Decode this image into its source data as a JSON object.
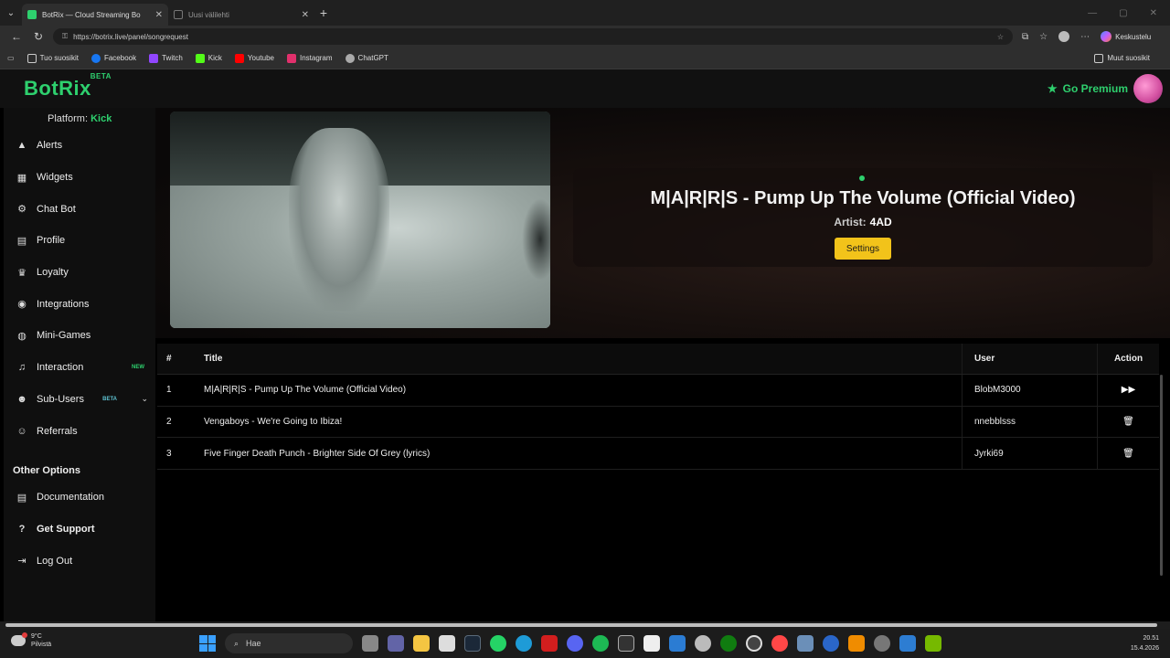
{
  "browser": {
    "tabs": [
      {
        "title": "BotRix — Cloud Streaming Bo",
        "active": true
      },
      {
        "title": "Uusi välilehti",
        "active": false
      }
    ],
    "url": "https://botrix.live/panel/songrequest",
    "copilot_label": "Keskustelu",
    "bookmarks": [
      {
        "label": "Tuo suosikit",
        "icon": "import-icon",
        "color": "#cccccc"
      },
      {
        "label": "Facebook",
        "icon": "facebook-icon",
        "color": "#1877f2"
      },
      {
        "label": "Twitch",
        "icon": "twitch-icon",
        "color": "#9146ff"
      },
      {
        "label": "Kick",
        "icon": "kick-icon",
        "color": "#53fc18"
      },
      {
        "label": "Youtube",
        "icon": "youtube-icon",
        "color": "#ff0000"
      },
      {
        "label": "Instagram",
        "icon": "instagram-icon",
        "color": "#e1306c"
      },
      {
        "label": "ChatGPT",
        "icon": "chatgpt-icon",
        "color": "#aaaaaa"
      }
    ],
    "other_bookmarks": "Muut suosikit"
  },
  "app": {
    "logo": "BotRix",
    "logo_badge": "BETA",
    "premium_label": "Go Premium",
    "platform_label": "Platform:",
    "platform_value": "Kick",
    "nav": [
      {
        "label": "Alerts",
        "icon": "warning-icon",
        "glyph": "▲"
      },
      {
        "label": "Widgets",
        "icon": "grid-icon",
        "glyph": "▦"
      },
      {
        "label": "Chat Bot",
        "icon": "robot-icon",
        "glyph": "⚙"
      },
      {
        "label": "Profile",
        "icon": "id-card-icon",
        "glyph": "▤"
      },
      {
        "label": "Loyalty",
        "icon": "trophy-icon",
        "glyph": "♛"
      },
      {
        "label": "Integrations",
        "icon": "integrations-icon",
        "glyph": "◉"
      },
      {
        "label": "Mini-Games",
        "icon": "gamepad-icon",
        "glyph": "◍"
      },
      {
        "label": "Interaction",
        "icon": "music-icon",
        "glyph": "♫",
        "badge": "NEW"
      },
      {
        "label": "Sub-Users",
        "icon": "users-icon",
        "glyph": "☻",
        "badge": "BETA"
      },
      {
        "label": "Referrals",
        "icon": "referrals-icon",
        "glyph": "☺"
      }
    ],
    "other_options_title": "Other Options",
    "other_nav": [
      {
        "label": "Documentation",
        "icon": "book-icon",
        "glyph": "▤"
      },
      {
        "label": "Get Support",
        "icon": "question-icon",
        "glyph": "?"
      },
      {
        "label": "Log Out",
        "icon": "logout-icon",
        "glyph": "⇥"
      }
    ],
    "now_playing": {
      "title": "M|A|R|R|S - Pump Up The Volume (Official Video)",
      "artist_label": "Artist:",
      "artist": "4AD",
      "settings_label": "Settings"
    },
    "queue": {
      "headers": {
        "num": "#",
        "title": "Title",
        "user": "User",
        "action": "Action"
      },
      "rows": [
        {
          "num": "1",
          "title": "M|A|R|R|S - Pump Up The Volume (Official Video)",
          "user": "BlobM3000",
          "action": "skip-icon"
        },
        {
          "num": "2",
          "title": "Vengaboys - We're Going to Ibiza!",
          "user": "nnebblsss",
          "action": "trash-icon"
        },
        {
          "num": "3",
          "title": "Five Finger Death Punch - Brighter Side Of Grey (lyrics)",
          "user": "Jyrki69",
          "action": "trash-icon"
        }
      ]
    }
  },
  "taskbar": {
    "weather_temp": "9°C",
    "weather_desc": "Pilvistä",
    "search_placeholder": "Hae",
    "time": "20.51",
    "date": "15.4.2026"
  }
}
